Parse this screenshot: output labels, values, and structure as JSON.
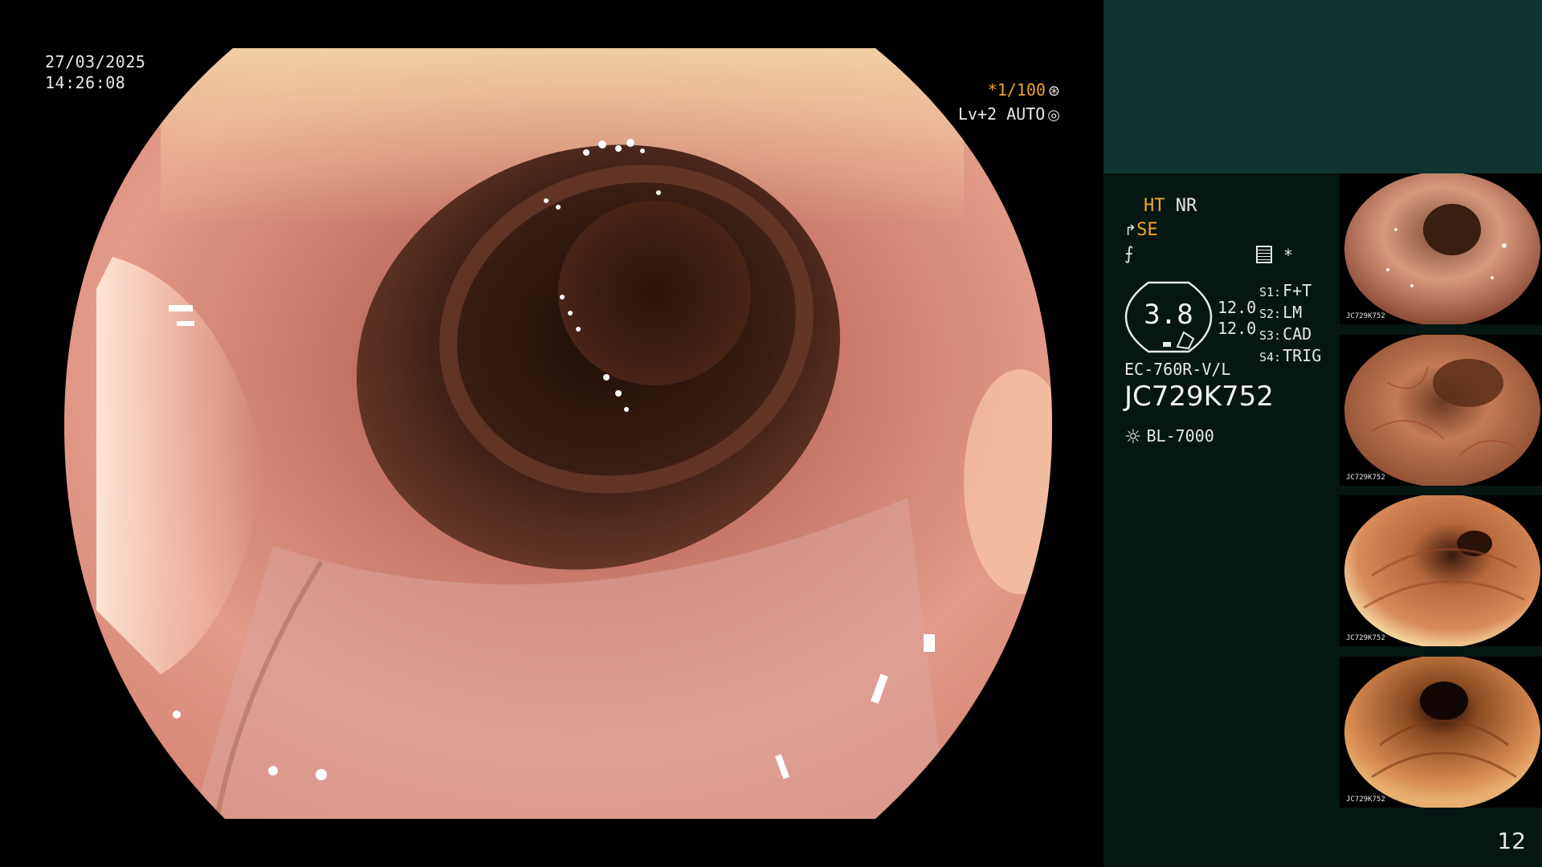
{
  "overlay": {
    "date": "27/03/2025",
    "time": "14:26:08",
    "shutter": "*1/100",
    "shutter_icon": "aperture-icon",
    "level": "Lv+2",
    "exposure_mode": "AUTO",
    "exposure_icon": "target-icon"
  },
  "panel": {
    "mode_ht": "HT",
    "mode_nr": "NR",
    "se_label": "SE",
    "wave_glyph": "⨍",
    "preset_star": "*",
    "zoom_value": "3.8",
    "gauge_value_1": "12.0",
    "gauge_value_2": "12.0",
    "slots": [
      {
        "key": "S1:",
        "value": "F+T"
      },
      {
        "key": "S2:",
        "value": "LM"
      },
      {
        "key": "S3:",
        "value": "CAD"
      },
      {
        "key": "S4:",
        "value": "TRIG"
      }
    ],
    "scope_model": "EC-760R-V/L",
    "scope_serial": "JC729K752",
    "light_source": "BL-7000",
    "colors": {
      "accent": "#f0a52a",
      "panel_bg": "#061612",
      "panel_header": "#0f3430"
    }
  },
  "thumbnails": {
    "labels": [
      "JC729K752",
      "JC729K752",
      "JC729K752",
      "JC729K752"
    ]
  },
  "footer": {
    "image_count": "12"
  }
}
